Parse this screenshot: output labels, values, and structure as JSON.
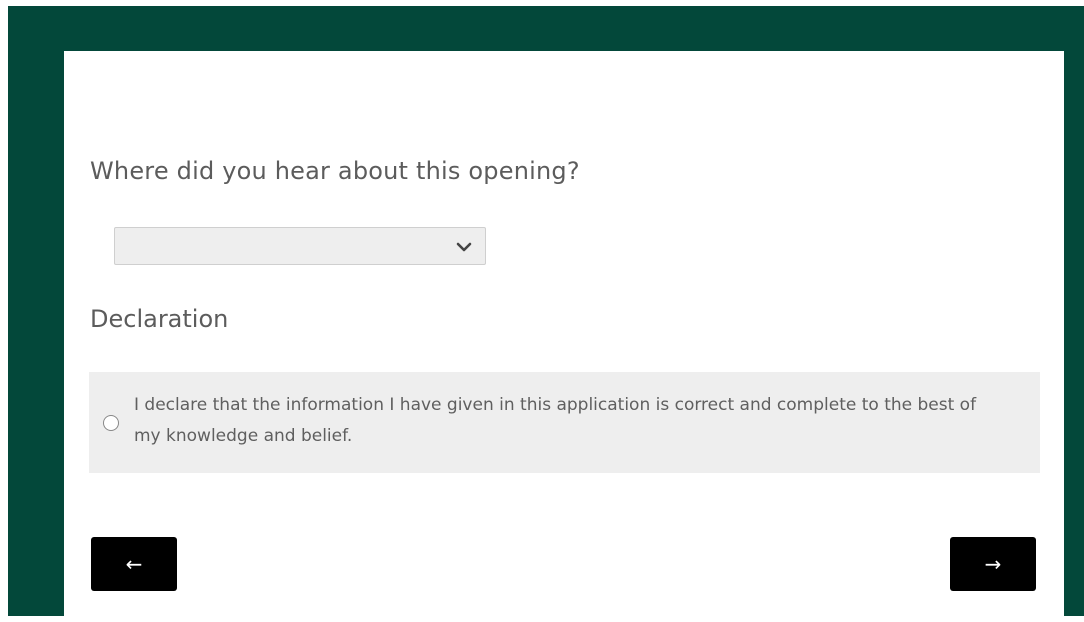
{
  "form": {
    "question": "Where did you hear about this opening?",
    "source_select": {
      "value": "",
      "icon": "chevron-down-icon"
    },
    "declaration_title": "Declaration",
    "declaration_text": "I declare that the information I have given in this application is correct and complete to the best of my knowledge and belief.",
    "declaration_checked": false
  },
  "navigation": {
    "back_label": "←",
    "next_label": "→"
  },
  "colors": {
    "frame": "#03483a",
    "card": "#ffffff",
    "field_bg": "#eeeeee",
    "button_bg": "#000000",
    "text": "#5c5c5c"
  }
}
